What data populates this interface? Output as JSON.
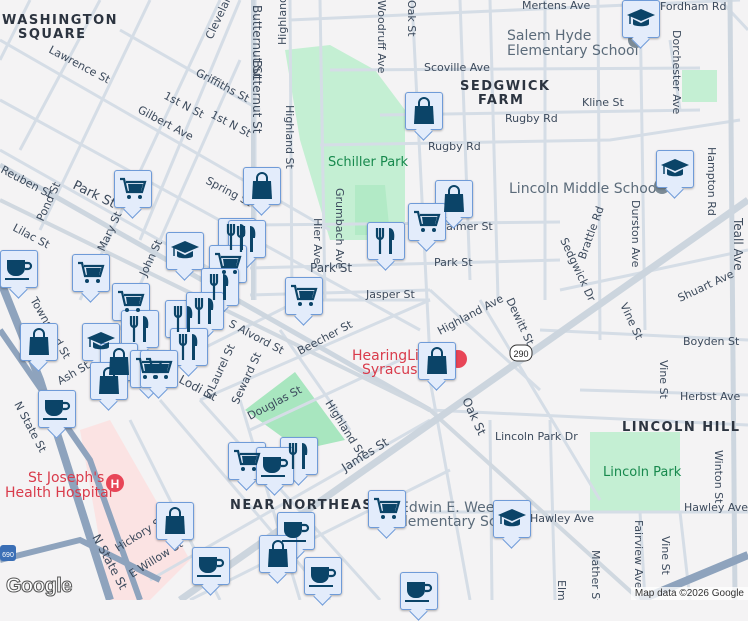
{
  "neighborhoods": [
    "WASHINGTON",
    "SQUARE",
    "SEDGWICK",
    "FARM",
    "LINCOLN HILL",
    "NEAR NORTHEAST"
  ],
  "places": {
    "schiller_park": "Schiller Park",
    "lincoln_park": "Lincoln Park",
    "salem_1": "Salem Hyde",
    "salem_2": "Elementary School",
    "lincoln_ms": "Lincoln Middle School",
    "weeks_1": "Edwin E. Weeks",
    "weeks_2": "Elementary School",
    "hospital_1": "St Joseph's",
    "hospital_2": "Health Hospital",
    "hearing_1": "HearingLife",
    "hearing_2": "Syracuse"
  },
  "streets": [
    "Lawrence St",
    "Griffiths St",
    "1st N St",
    "1st N St",
    "Gilbert Ave",
    "Spring St",
    "Park St",
    "Park St",
    "Park St",
    "Reuben St",
    "Pond St",
    "Lilac St",
    "Mary St",
    "John St",
    "Butternut St",
    "Butternut St",
    "Highland St",
    "Highland St",
    "Hier Ave",
    "Grumbach Ave",
    "Jasper St",
    "Beecher St",
    "S Alvord St",
    "E Laurel St",
    "Seward St",
    "Lodi St",
    "Douglas St",
    "Highland St",
    "James St",
    "N State St",
    "N State St",
    "Hickory St",
    "E Willow St",
    "Mertens Ave",
    "Fordham Rd",
    "Scoville Ave",
    "Kline St",
    "Rugby Rd",
    "Rugby Rd",
    "Palmer St",
    "Highland Ave",
    "Dewitt St",
    "Sedgwick Dr",
    "Brattle Rd",
    "Durston Ave",
    "Hampton Rd",
    "Dorchester Ave",
    "Teall Ave",
    "Shuart Ave",
    "Vine St",
    "Boyden St",
    "Vine St",
    "Herbst Ave",
    "Oak St",
    "Lincoln Park Dr",
    "Hawley Ave",
    "Hawley Ave",
    "Winton St",
    "Mather St",
    "Fairview Ave",
    "Vine St",
    "Elm St",
    "Cleveland Ave",
    "Woodruff Ave",
    "Oak St",
    "Townsend St",
    "Ash St"
  ],
  "highway_shield": "290",
  "interstate_shield": "690",
  "attribution": "Map data ©2026 Google",
  "logo": "Google",
  "markers": [
    "shopping-cart",
    "shopping-bag",
    "graduation-cap",
    "restaurant",
    "coffee-cup"
  ],
  "colors": {
    "marker_icon": "#0b4468",
    "marker_bg": "#e3ecfb",
    "park": "#c4efd3",
    "highway": "#8ea3bd",
    "hospital": "#fbe3e3"
  }
}
